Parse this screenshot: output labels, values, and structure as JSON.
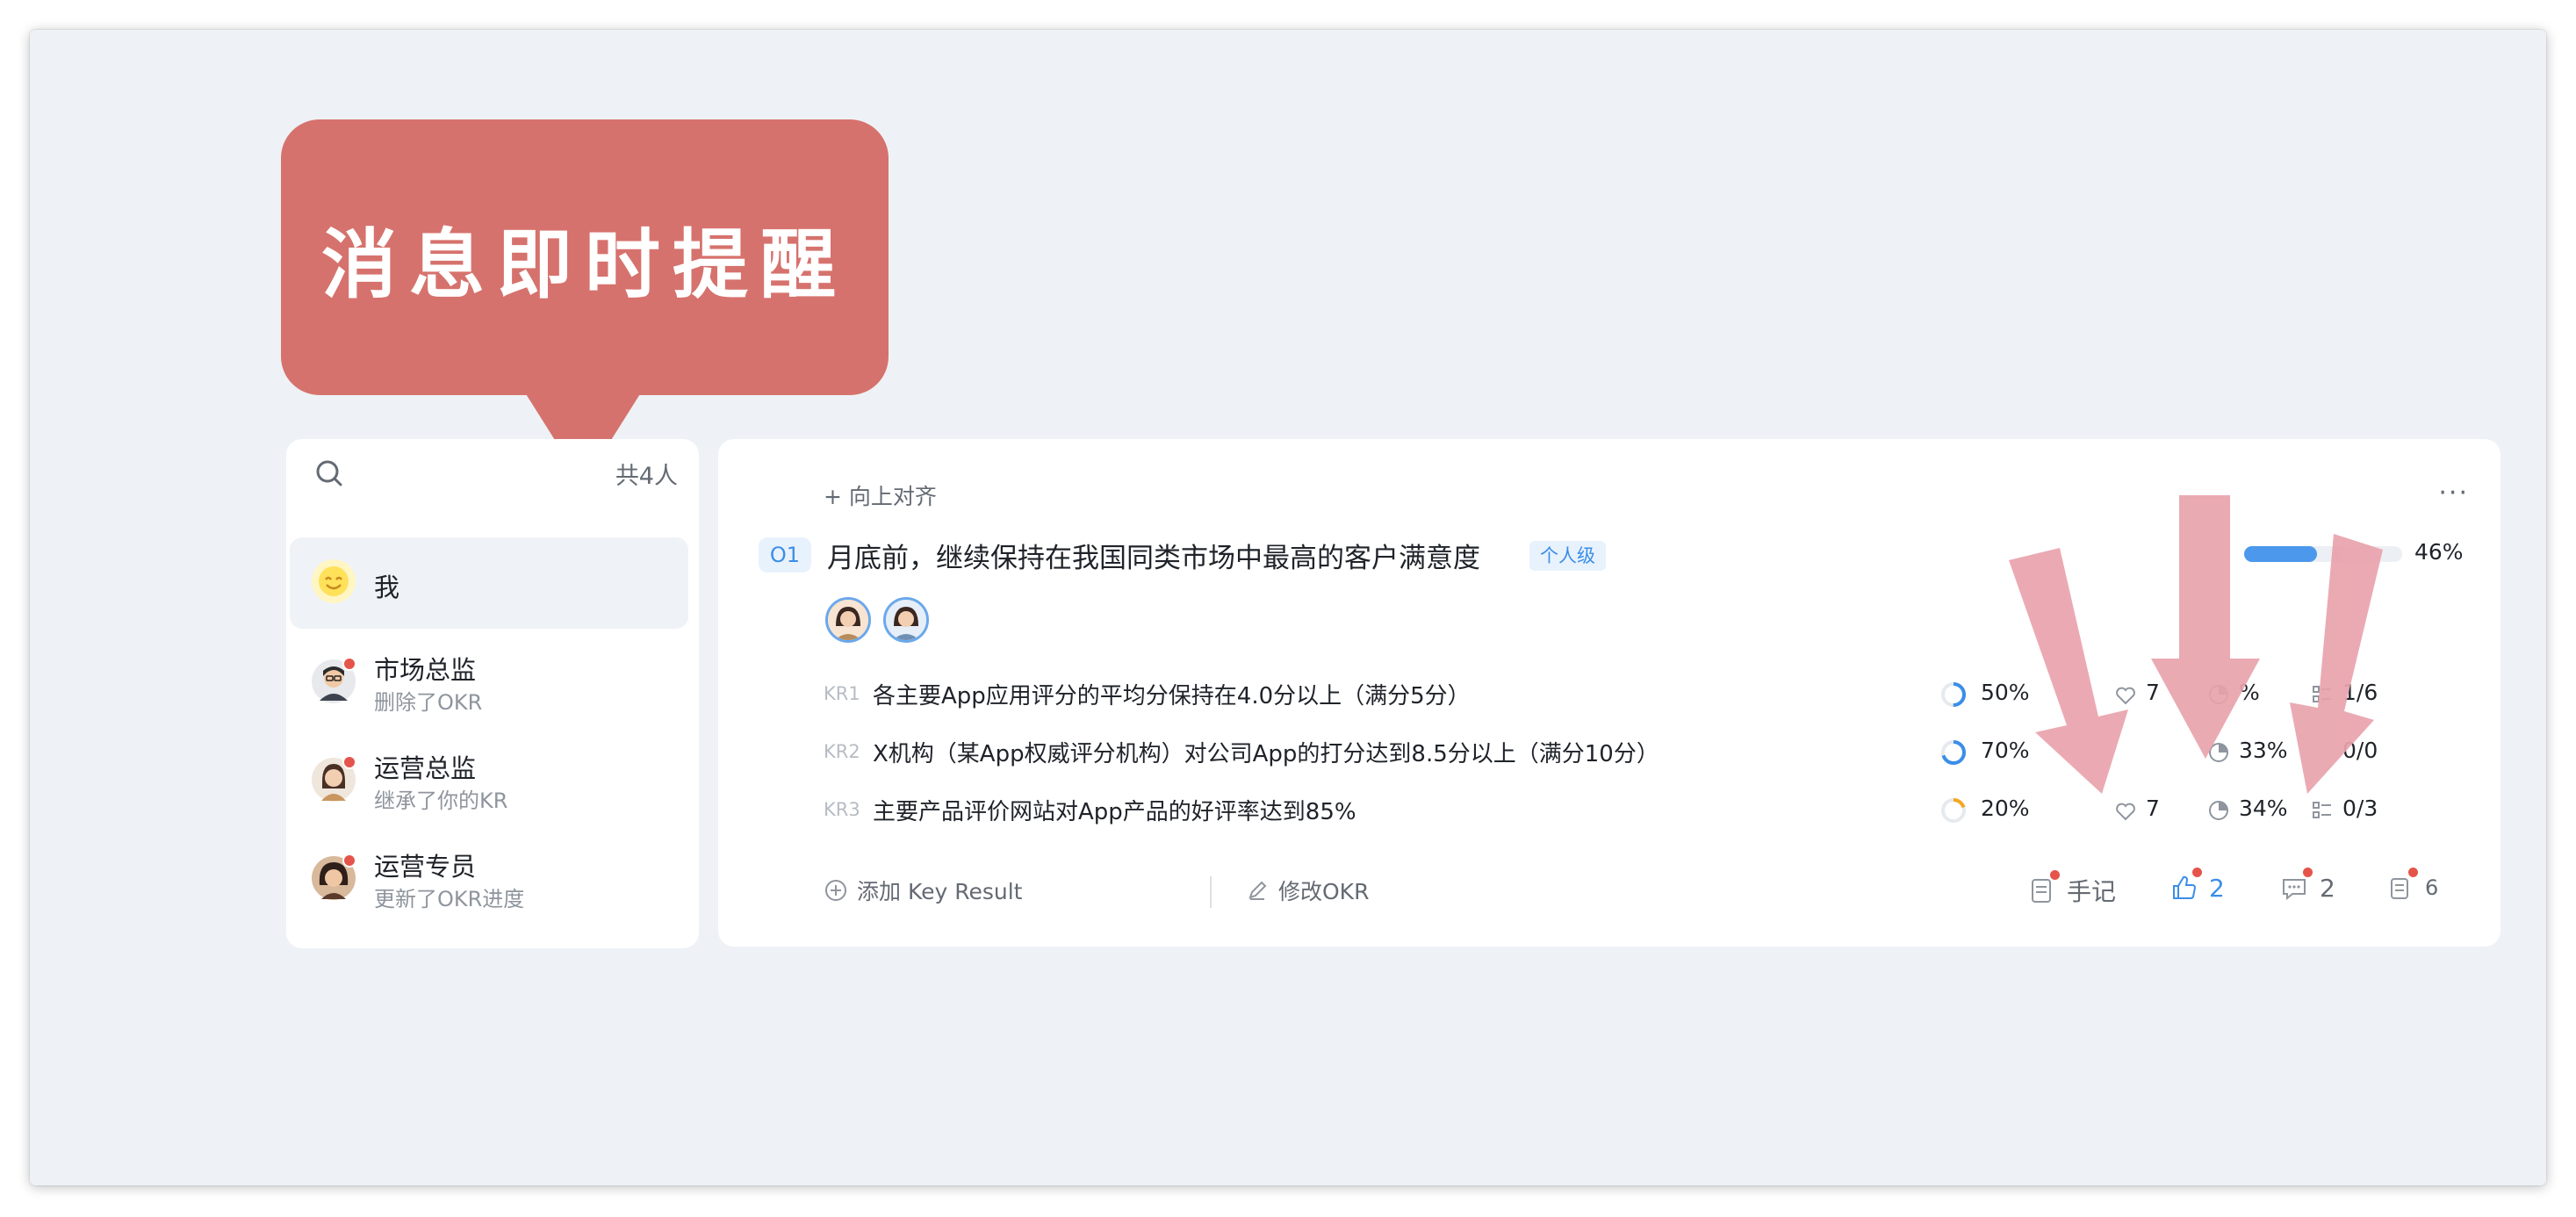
{
  "callout": {
    "text": "消息即时提醒"
  },
  "members": {
    "count_label": "共4人",
    "items": [
      {
        "name": "我",
        "sub": "",
        "avatar": "smiley-face"
      },
      {
        "name": "市场总监",
        "sub": "删除了OKR",
        "avatar": "man-avatar"
      },
      {
        "name": "运营总监",
        "sub": "继承了你的KR",
        "avatar": "woman-avatar"
      },
      {
        "name": "运营专员",
        "sub": "更新了OKR进度",
        "avatar": "woman-avatar"
      }
    ]
  },
  "objective": {
    "align_label": "+ 向上对齐",
    "more_label": "···",
    "badge": "O1",
    "title": "月底前，继续保持在我国同类市场中最高的客户满意度",
    "level_tag": "个人级",
    "progress": 46,
    "progress_label": "46%"
  },
  "key_results": [
    {
      "tag": "KR1",
      "text": "各主要App应用评分的平均分保持在4.0分以上（满分5分）",
      "progress": 50,
      "progress_label": "50%",
      "ring_color": "#3b8ee8",
      "likes": "7",
      "confidence": "%",
      "tasks": "1/6"
    },
    {
      "tag": "KR2",
      "text": "X机构（某App权威评分机构）对公司App的打分达到8.5分以上（满分10分）",
      "progress": 70,
      "progress_label": "70%",
      "ring_color": "#3b8ee8",
      "likes": "",
      "confidence": "33%",
      "tasks": "0/0"
    },
    {
      "tag": "KR3",
      "text": "主要产品评价网站对App产品的好评率达到85%",
      "progress": 20,
      "progress_label": "20%",
      "ring_color": "#f5a623",
      "likes": "7",
      "confidence": "34%",
      "tasks": "0/3"
    }
  ],
  "footer": {
    "add_kr": "添加 Key Result",
    "edit_okr": "修改OKR",
    "notes": "手记",
    "likes": "2",
    "comments": "2",
    "records": "6"
  },
  "colors": {
    "callout": "#d6726d",
    "accent": "#3b8ee8",
    "arrow": "#e9a3ac",
    "notify_dot": "#e5544b"
  }
}
